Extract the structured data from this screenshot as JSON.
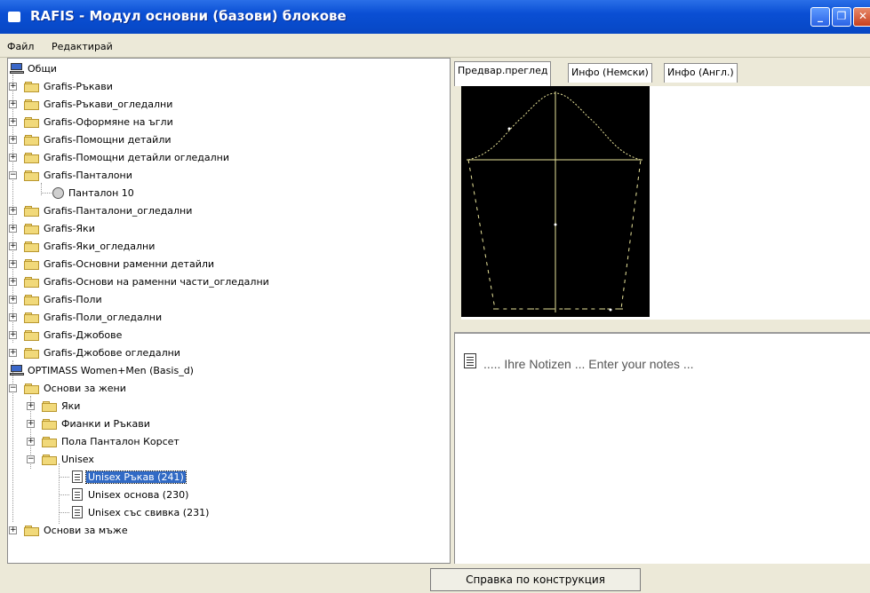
{
  "window": {
    "title": "RAFIS - Модул основни (базови) блокове"
  },
  "menu": [
    "Файл",
    "Редактирай"
  ],
  "tree": {
    "roots": [
      {
        "label": "Общи",
        "children": [
          "Grafis-Ръкави",
          "Grafis-Ръкави_огледални",
          "Grafis-Оформяне на ъгли",
          "Grafis-Помощни детайли",
          "Grafis-Помощни детайли огледални",
          "Grafis-Панталони",
          "Панталон 10",
          "Grafis-Панталони_огледални",
          "Grafis-Яки",
          "Grafis-Яки_огледални",
          "Grafis-Основни раменни детайли",
          "Grafis-Основи на раменни части_огледални",
          "Grafis-Поли",
          "Grafis-Поли_огледални",
          "Grafis-Джобове",
          "Grafis-Джобове огледални"
        ]
      },
      {
        "label": "OPTIMASS Women+Men (Basis_d)",
        "children": [
          "Основи за жени",
          "Яки",
          "Фианки и Ръкави",
          "Пола Панталон Корсет",
          "Unisex",
          "Unisex Ръкав (241)",
          "Unisex основа (230)",
          "Unisex със свивка (231)",
          "Основи за мъже"
        ]
      }
    ]
  },
  "tabs": [
    "Предвар.преглед",
    "Инфо (Немски)",
    "Инфо (Англ.)"
  ],
  "notes": {
    "text": "..... Ihre Notizen ... Enter your notes ..."
  },
  "footer": {
    "button_label": "Справка по конструкция"
  },
  "colors": {
    "selection": "#316ac5",
    "titlebar": "#0a4fd4",
    "folder": "#f1d97a",
    "preview_bg": "#000000",
    "pattern_line": "#e8e39a"
  }
}
